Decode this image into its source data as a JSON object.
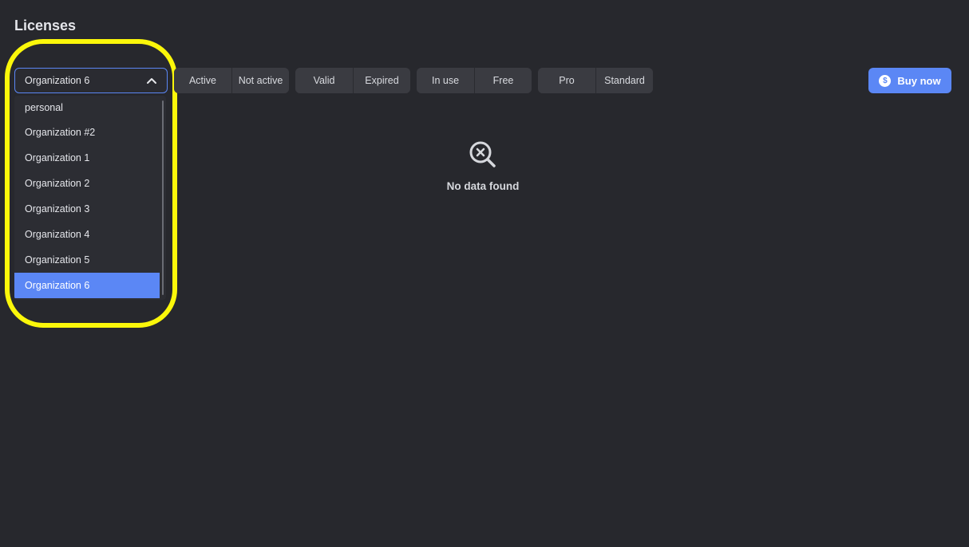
{
  "page": {
    "title": "Licenses"
  },
  "org_select": {
    "selected": "Organization 6",
    "options": [
      "personal",
      "Organization #2",
      "Organization 1",
      "Organization 2",
      "Organization 3",
      "Organization 4",
      "Organization 5",
      "Organization 6"
    ],
    "selected_index": 7
  },
  "filters": {
    "status": [
      "Active",
      "Not active"
    ],
    "validity": [
      "Valid",
      "Expired"
    ],
    "usage": [
      "In use",
      "Free"
    ],
    "tier": [
      "Pro",
      "Standard"
    ]
  },
  "buy_button": {
    "label": "Buy now",
    "icon": "dollar-icon",
    "icon_glyph": "$"
  },
  "empty_state": {
    "icon": "search-x-icon",
    "text": "No data found"
  },
  "colors": {
    "background": "#27282d",
    "accent": "#5b87f5",
    "segment": "#3a3b41",
    "highlight": "#fbf70a"
  }
}
